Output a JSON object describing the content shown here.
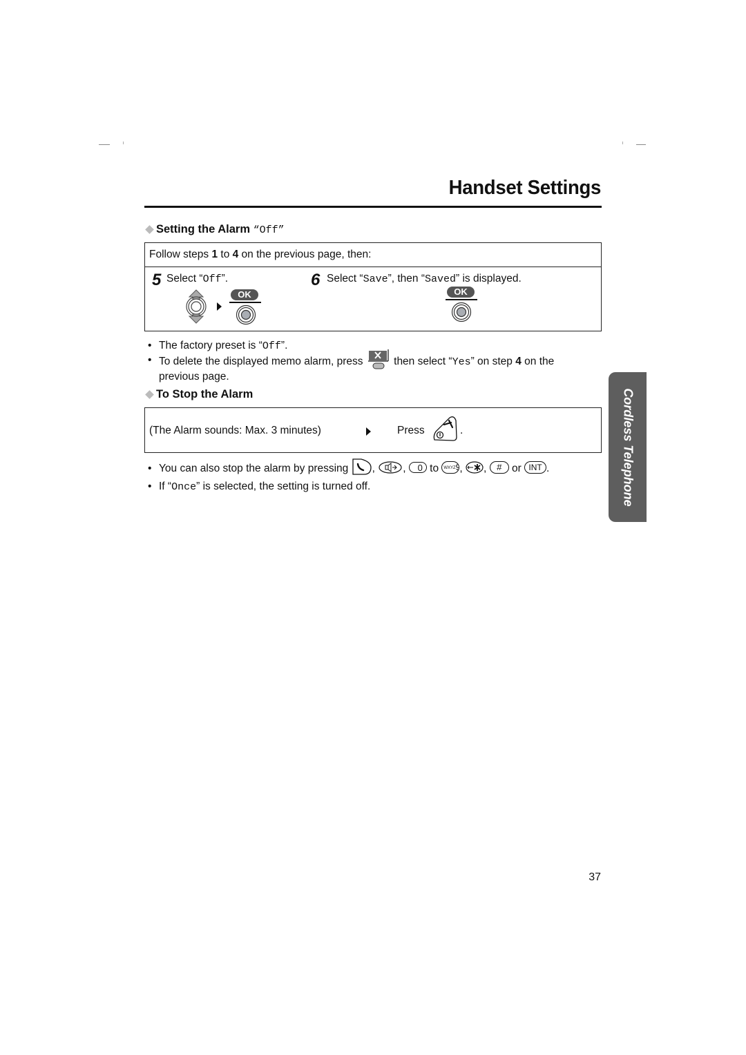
{
  "header": {
    "title": "Handset Settings"
  },
  "section_off": {
    "heading": "Setting the Alarm ",
    "heading_value": "“Off”",
    "intro_prefix": "Follow steps ",
    "intro_step_a": "1",
    "intro_mid": " to ",
    "intro_step_b": "4",
    "intro_suffix": " on the previous page, then:",
    "steps": [
      {
        "number": "5",
        "prefix": "Select “",
        "value": "Off",
        "suffix": "”.",
        "ok_label": "OK"
      },
      {
        "number": "6",
        "prefix": "Select “",
        "value": "Save",
        "mid": "”, then “",
        "value2": "Saved",
        "suffix": "” is displayed.",
        "ok_label": "OK"
      }
    ],
    "notes": [
      {
        "prefix": "The factory preset is “",
        "value": "Off",
        "suffix": "”."
      },
      {
        "prefix": "To delete the displayed memo alarm, press ",
        "mid": " then select “",
        "value": "Yes",
        "mid2": "” on step ",
        "step": "4",
        "suffix": " on the previous page."
      }
    ]
  },
  "section_stop": {
    "heading": "To Stop the Alarm",
    "condition": "(The Alarm sounds: Max. 3 minutes)",
    "action": "Press",
    "action_suffix": ".",
    "notes": [
      {
        "prefix": "You can also stop the alarm by pressing ",
        "sep": ", ",
        "to": " to ",
        "or": " or ",
        "end": "."
      },
      {
        "prefix": "If “",
        "value": "Once",
        "suffix": "” is selected, the setting is turned off."
      }
    ],
    "keys": {
      "zero": "0",
      "nine": "9",
      "nine_letters": "WXYZ",
      "hash": "#",
      "int": "INT"
    }
  },
  "side_tab": {
    "label": "Cordless Telephone"
  },
  "footer": {
    "page_number": "37"
  }
}
